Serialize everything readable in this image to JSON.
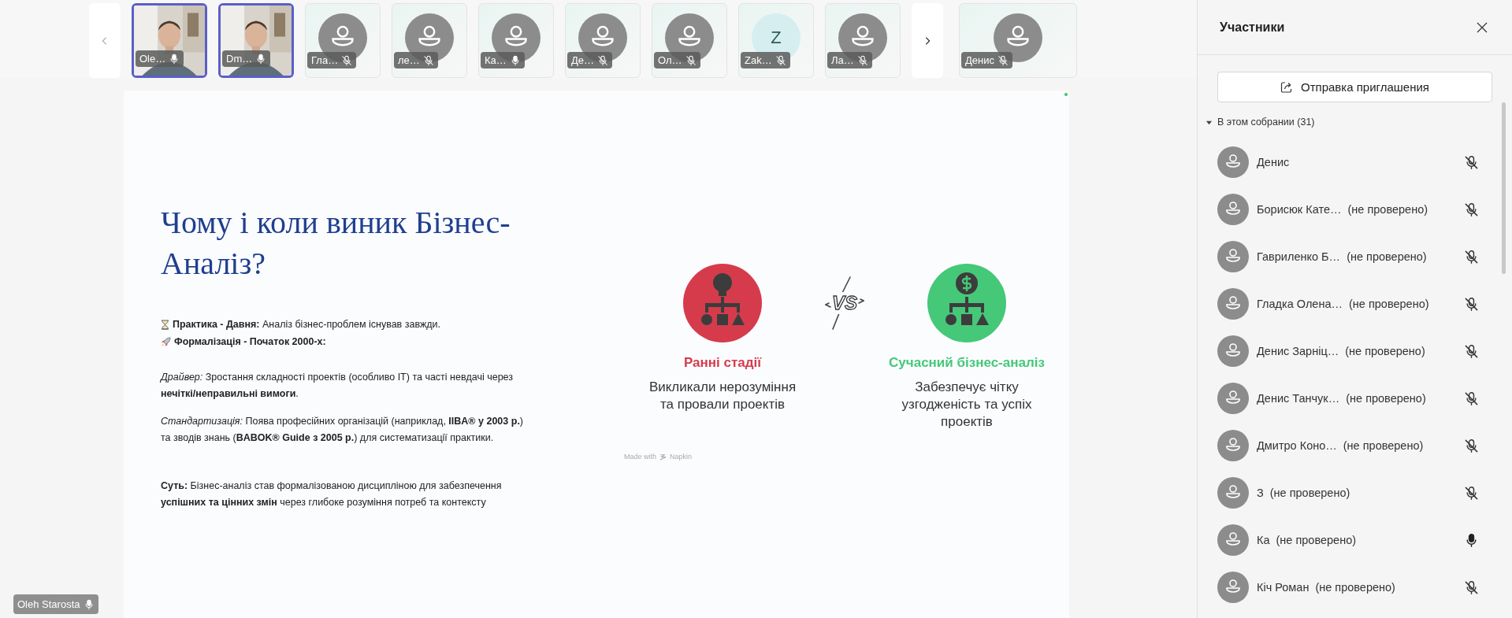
{
  "filmstrip": {
    "tiles": [
      {
        "kind": "video",
        "name": "Ole…",
        "muted": false,
        "selected": true
      },
      {
        "kind": "video",
        "name": "Dm…",
        "muted": false,
        "selected": true
      },
      {
        "kind": "avatar",
        "name": "Гла…",
        "muted": true,
        "selected": false
      },
      {
        "kind": "avatar",
        "name": "ле…",
        "muted": true,
        "selected": false
      },
      {
        "kind": "avatar",
        "name": "Ка…",
        "muted": false,
        "selected": false
      },
      {
        "kind": "avatar",
        "name": "Де…",
        "muted": true,
        "selected": false
      },
      {
        "kind": "avatar",
        "name": "Ол…",
        "muted": true,
        "selected": false
      },
      {
        "kind": "initial",
        "initial": "Z",
        "name": "Zak…",
        "muted": true,
        "selected": false
      },
      {
        "kind": "avatar",
        "name": "Ла…",
        "muted": true,
        "selected": false
      }
    ],
    "pinned_tile": {
      "kind": "avatar",
      "name": "Денис",
      "muted": true
    }
  },
  "slide": {
    "title": "Чому і коли виник Бізнес-Аналіз?",
    "points": [
      {
        "text": "**Практика - Давня:** Аналіз бізнес-проблем існував завжди.",
        "bold": false
      },
      {
        "text": "Формалізація - Початок 2000-х:",
        "bold": true
      }
    ],
    "paragraphs": [
      "*Драйвер:* Зростання складності проектів (особливо IT) та часті невдачі через **нечіткі/неправильні вимоги**.",
      "*Стандартизація:* Поява професійних організацій (наприклад, **IIBA® у 2003 р.**) та зводів знань (**BABOK® Guide з 2005 р.**) для систематизації практики.",
      "**Суть:** Бізнес-аналіз став формалізованою дисципліною для забезпечення **успішних та цінних змін** через глибоке розуміння потреб та контексту"
    ],
    "comparison": [
      {
        "kind": "early",
        "title": "Ранні стадії",
        "description": "Викликали нерозуміння та провали проектів",
        "color": "#d63b4c"
      },
      {
        "kind": "modern",
        "title": "Сучасний бізнес-аналіз",
        "description": "Забезпечує чітку узгодженість та успіх проектів",
        "color": "#45c878"
      }
    ],
    "vs_label": "VS",
    "credit": {
      "prefix": "Made with",
      "brand": "Napkin"
    }
  },
  "presenter_label": {
    "name": "Oleh Starosta",
    "muted": false
  },
  "participants_panel": {
    "title": "Участники",
    "invite_button": "Отправка приглашения",
    "section": {
      "label": "В этом собрании (31)",
      "expanded": true
    },
    "people": [
      {
        "name": "Денис",
        "muted": true
      },
      {
        "name": "Борисюк Кате…",
        "status": "(не проверено)",
        "muted": true
      },
      {
        "name": "Гавриленко Б…",
        "status": "(не проверено)",
        "muted": true
      },
      {
        "name": "Гладка Олена…",
        "status": "(не проверено)",
        "muted": true
      },
      {
        "name": "Денис Зарніц…",
        "status": "(не проверено)",
        "muted": true
      },
      {
        "name": "Денис Танчук…",
        "status": "(не проверено)",
        "muted": true
      },
      {
        "name": "Дмитро Коно…",
        "status": "(не проверено)",
        "muted": true
      },
      {
        "name": "З",
        "status": "(не проверено)",
        "muted": true
      },
      {
        "name": "Ка",
        "status": "(не проверено)",
        "muted": false
      },
      {
        "name": "Кіч Роман",
        "status": "(не проверено)",
        "muted": true
      }
    ]
  }
}
